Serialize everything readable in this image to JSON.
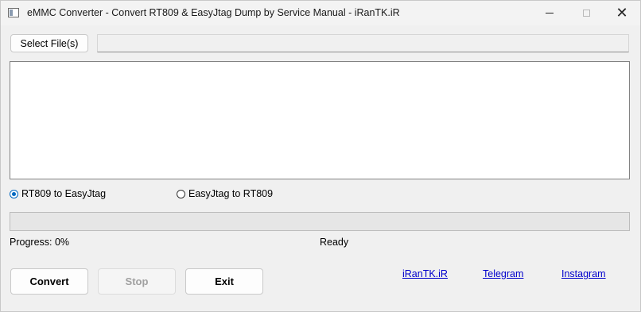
{
  "window": {
    "title": "eMMC Converter - Convert RT809 & EasyJtag Dump by Service Manual - iRanTK.iR",
    "controls": [
      "minimize-icon",
      "maximize-icon",
      "close-icon"
    ],
    "close_glyph": "✕"
  },
  "file": {
    "select_label": "Select File(s)",
    "path_value": ""
  },
  "log": {
    "text": ""
  },
  "mode": {
    "options": [
      {
        "label": "RT809 to EasyJtag",
        "selected": true
      },
      {
        "label": "EasyJtag to RT809",
        "selected": false
      }
    ]
  },
  "progress": {
    "value_percent": 0,
    "label": "Progress: 0%",
    "status": "Ready",
    "fill_color": "#06b025"
  },
  "actions": {
    "convert": "Convert",
    "stop": "Stop",
    "exit": "Exit"
  },
  "links": {
    "irantk": "iRanTK.iR",
    "telegram": "Telegram",
    "instagram": "Instagram",
    "color": "#0000cc"
  }
}
